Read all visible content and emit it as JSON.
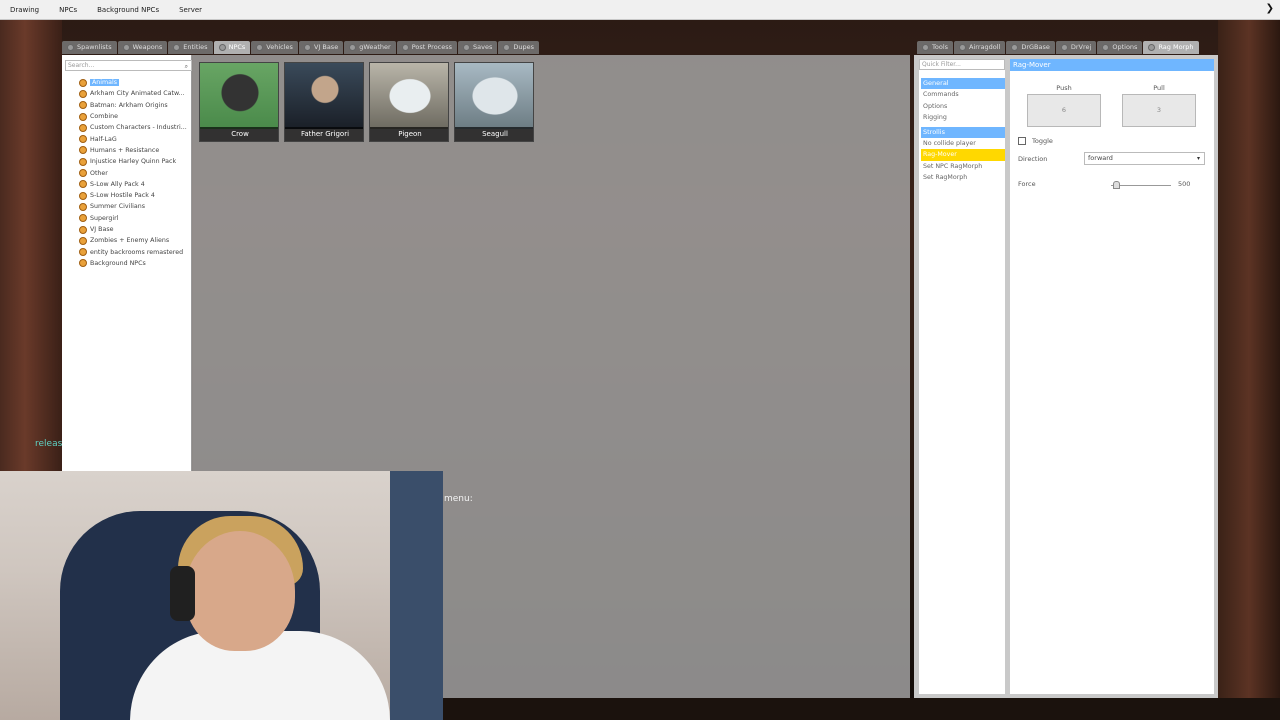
{
  "menubar": {
    "items": [
      "Drawing",
      "NPCs",
      "Background NPCs",
      "Server"
    ],
    "close_glyph": "❯"
  },
  "spawnmenu": {
    "tabs": [
      "Spawnlists",
      "Weapons",
      "Entities",
      "NPCs",
      "Vehicles",
      "VJ Base",
      "gWeather",
      "Post Process",
      "Saves",
      "Dupes"
    ],
    "active_tab": "NPCs",
    "search_placeholder": "Search...",
    "tree": [
      "Animals",
      "Arkham City Animated Catw...",
      "Batman: Arkham Origins",
      "Combine",
      "Custom Characters - Industri...",
      "Half-LaG",
      "Humans + Resistance",
      "Injustice Harley Quinn Pack",
      "Other",
      "S-Low Ally Pack 4",
      "S-Low Hostile Pack 4",
      "Summer Civilians",
      "Supergirl",
      "VJ Base",
      "Zombies + Enemy Aliens",
      "entity backrooms remastered",
      "Background NPCs"
    ],
    "selected_tree_item": "Animals",
    "npcs": [
      "Crow",
      "Father Grigori",
      "Pigeon",
      "Seagull"
    ]
  },
  "overlay": {
    "chat_text": "releas",
    "menu_text": "menu:"
  },
  "context": {
    "tabs": [
      "Tools",
      "Airragdoll",
      "DrGBase",
      "DrVrej",
      "Options",
      "Rag Morph"
    ],
    "active_tab": "Rag Morph",
    "filter_placeholder": "Quick Filter...",
    "categories": [
      {
        "head": "General",
        "items": [
          "Commands",
          "Options",
          "Rigging"
        ]
      },
      {
        "head": "Strollis",
        "items": [
          "No collide player",
          "Rag-Mover",
          "Set NPC RagMorph",
          "Set RagMorph"
        ]
      }
    ],
    "active_item": "Rag-Mover",
    "tool": {
      "title": "Rag-Mover",
      "push_label": "Push",
      "push_value": "6",
      "pull_label": "Pull",
      "pull_value": "3",
      "toggle_label": "Toggle",
      "direction_label": "Direction",
      "direction_value": "forward",
      "force_label": "Force",
      "force_value": "500",
      "force_fraction": 0.1
    }
  }
}
